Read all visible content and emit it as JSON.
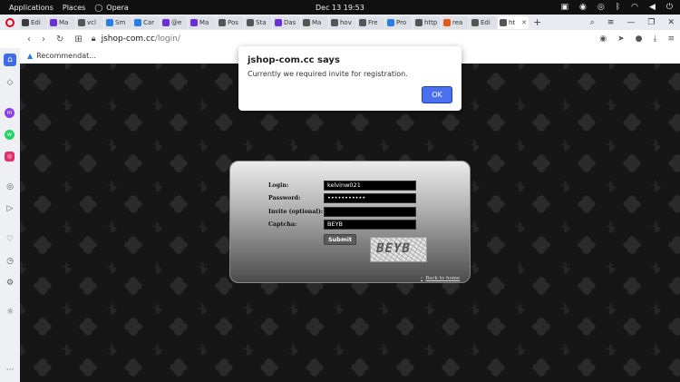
{
  "topbar": {
    "applications": "Applications",
    "places": "Places",
    "browser": "Opera",
    "clock": "Dec 13  19:53"
  },
  "tabs": [
    {
      "label": "Edi",
      "color": "#3a3a3a"
    },
    {
      "label": "Ma",
      "color": "#6b2fd8"
    },
    {
      "label": "vcl",
      "color": "#555"
    },
    {
      "label": "Sm",
      "color": "#2a7de1"
    },
    {
      "label": "Car",
      "color": "#2a7de1"
    },
    {
      "label": "@e",
      "color": "#6b2fd8"
    },
    {
      "label": "Ma",
      "color": "#6b2fd8"
    },
    {
      "label": "Pos",
      "color": "#555"
    },
    {
      "label": "Sta",
      "color": "#555"
    },
    {
      "label": "Das",
      "color": "#6b2fd8"
    },
    {
      "label": "Ma",
      "color": "#555"
    },
    {
      "label": "hov",
      "color": "#555"
    },
    {
      "label": "Fre",
      "color": "#555"
    },
    {
      "label": "Pro",
      "color": "#2a7de1"
    },
    {
      "label": "http",
      "color": "#555"
    },
    {
      "label": "rea",
      "color": "#e25a1c"
    },
    {
      "label": "Edi",
      "color": "#555"
    },
    {
      "label": "ht",
      "color": "#555",
      "active": true
    }
  ],
  "address": {
    "host": "jshop-com.cc",
    "path": "/login/"
  },
  "bookmarks": {
    "item": "Recommendat..."
  },
  "form": {
    "login_label": "Login:",
    "login_value": "kelvinw021",
    "password_label": "Password:",
    "password_value": "•••••••••••",
    "invite_label": "Invite (optional):",
    "invite_value": "",
    "captcha_label": "Captcha:",
    "captcha_value": "BEYB",
    "submit_label": "Submit",
    "captcha_image_text": "BEYB",
    "back_link": "Back to home"
  },
  "dialog": {
    "title": "jshop-com.cc says",
    "message": "Currently we required invite for registration.",
    "ok_label": "OK"
  }
}
